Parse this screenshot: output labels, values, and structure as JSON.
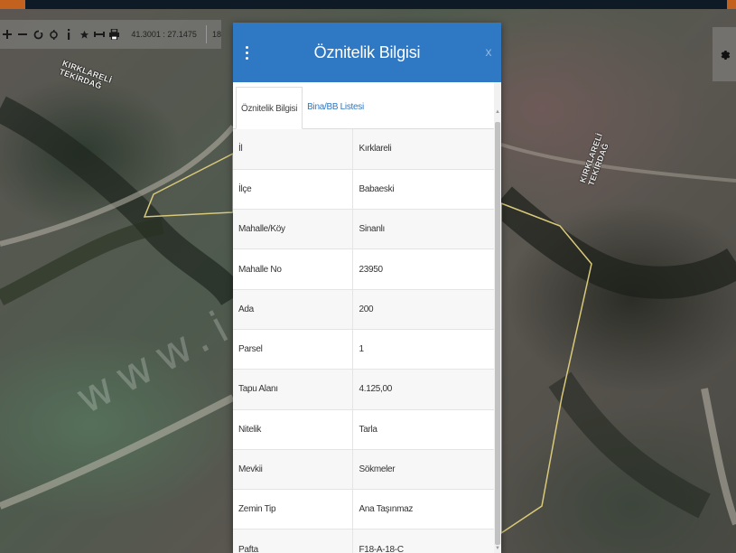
{
  "toolbar": {
    "coordinates": "41.3001 : 27.1475",
    "zoom_level": "18",
    "tools": [
      {
        "icon": "zoom-in-icon"
      },
      {
        "icon": "zoom-out-icon"
      },
      {
        "icon": "refresh-icon"
      },
      {
        "icon": "locate-icon"
      },
      {
        "icon": "info-icon"
      },
      {
        "icon": "star-icon"
      },
      {
        "icon": "measure-icon"
      },
      {
        "icon": "print-icon"
      }
    ]
  },
  "map": {
    "labels": {
      "left_top": "KIRKLARELİ",
      "left_bottom": "TEKİRDAĞ",
      "right_top": "KIRKLARELİ",
      "right_bottom": "TEKİRDAĞ"
    },
    "watermark": "www.i          .net.tr",
    "colors": {
      "parcel_outline": "#d9c97a"
    }
  },
  "panel": {
    "title": "Öznitelik Bilgisi",
    "close_label": "x",
    "header_color": "#2f78c4",
    "tabs": [
      {
        "label": "Öznitelik Bilgisi",
        "active": true
      },
      {
        "label": "Bina/BB Listesi",
        "active": false
      }
    ],
    "rows": [
      {
        "key": "İl",
        "value": "Kırklareli"
      },
      {
        "key": "İlçe",
        "value": "Babaeski"
      },
      {
        "key": "Mahalle/Köy",
        "value": "Sinanlı"
      },
      {
        "key": "Mahalle No",
        "value": "23950"
      },
      {
        "key": "Ada",
        "value": "200"
      },
      {
        "key": "Parsel",
        "value": "1"
      },
      {
        "key": "Tapu Alanı",
        "value": "4.125,00"
      },
      {
        "key": "Nitelik",
        "value": "Tarla"
      },
      {
        "key": "Mevkii",
        "value": "Sökmeler"
      },
      {
        "key": "Zemin Tip",
        "value": "Ana Taşınmaz"
      },
      {
        "key": "Pafta",
        "value": "F18-A-18-C"
      }
    ]
  }
}
